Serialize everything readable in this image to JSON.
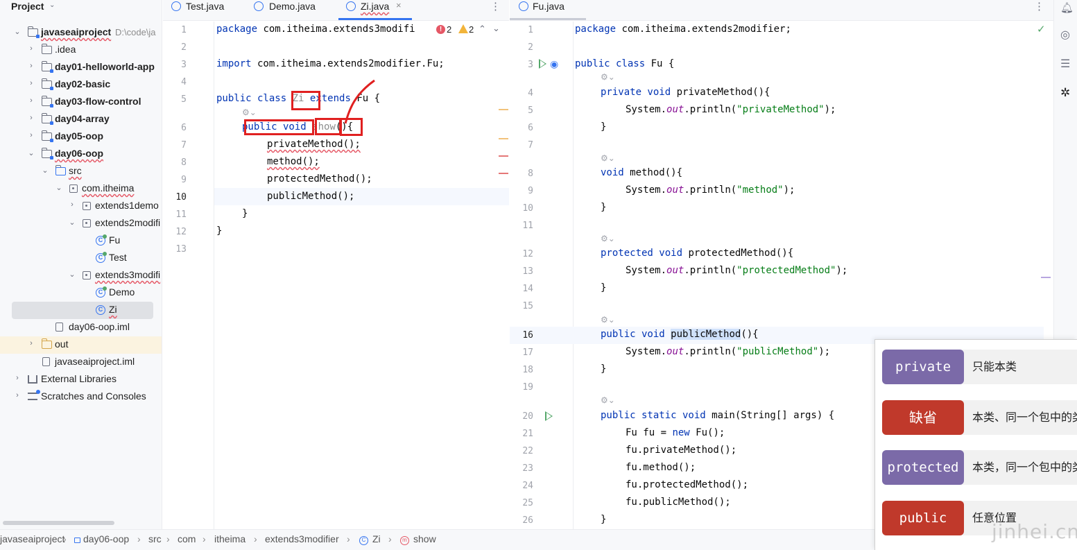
{
  "project_panel": {
    "title": "Project",
    "root": {
      "name": "javaseaiproject",
      "path": "D:\\code\\ja"
    },
    "items": [
      {
        "label": ".idea"
      },
      {
        "label": "day01-helloworld-app"
      },
      {
        "label": "day02-basic"
      },
      {
        "label": "day03-flow-control"
      },
      {
        "label": "day04-array"
      },
      {
        "label": "day05-oop"
      },
      {
        "label": "day06-oop"
      },
      {
        "label": "src"
      },
      {
        "label": "com.itheima"
      },
      {
        "label": "extends1demo"
      },
      {
        "label": "extends2modifi"
      },
      {
        "label": "Fu"
      },
      {
        "label": "Test"
      },
      {
        "label": "extends3modifi"
      },
      {
        "label": "Demo"
      },
      {
        "label": "Zi"
      },
      {
        "label": "day06-oop.iml"
      },
      {
        "label": "out"
      },
      {
        "label": "javaseaiproject.iml"
      },
      {
        "label": "External Libraries"
      },
      {
        "label": "Scratches and Consoles"
      }
    ]
  },
  "left_editor": {
    "tabs": [
      {
        "label": "Test.java"
      },
      {
        "label": "Demo.java"
      },
      {
        "label": "Zi.java",
        "close": "×"
      }
    ],
    "inspections": {
      "errors": "2",
      "warnings": "2"
    },
    "line_numbers": [
      "1",
      "2",
      "3",
      "4",
      "5",
      "6",
      "7",
      "8",
      "9",
      "10",
      "11",
      "12",
      "13"
    ],
    "code": {
      "l1_kw": "package",
      "l1_rest": " com.itheima.extends3modifi",
      "l3_kw": "import",
      "l3_rest": " com.itheima.extends2modifier.Fu;",
      "l5_kw1": "public class",
      "l5_cls": "Zi",
      "l5_kw2": "extends",
      "l5_rest": " Fu {",
      "l6_kw": "public void",
      "l6_name": "show",
      "l6_rest": "(){",
      "l7": "privateMethod();",
      "l8": "method();",
      "l9": "protectedMethod();",
      "l10": "publicMethod();",
      "l11": "}",
      "l12": "}"
    }
  },
  "right_editor": {
    "tabs": [
      {
        "label": "Fu.java"
      }
    ],
    "line_numbers": [
      "1",
      "2",
      "3",
      "4",
      "5",
      "6",
      "7",
      "8",
      "9",
      "10",
      "11",
      "12",
      "13",
      "14",
      "15",
      "16",
      "17",
      "18",
      "19",
      "20",
      "21",
      "22",
      "23",
      "24",
      "25",
      "26"
    ],
    "code": {
      "l1_kw": "package",
      "l1_rest": " com.itheima.extends2modifier;",
      "l3_kw": "public class",
      "l3_rest": " Fu {",
      "l4_kw": "private void",
      "l4_rest": " privateMethod(){",
      "l5_a": "System.",
      "l5_f": "out",
      "l5_b": ".println(",
      "l5_s": "\"privateMethod\"",
      "l5_c": ");",
      "l6": "}",
      "l8_kw": "void",
      "l8_rest": " method(){",
      "l9_a": "System.",
      "l9_f": "out",
      "l9_b": ".println(",
      "l9_s": "\"method\"",
      "l9_c": ");",
      "l10": "}",
      "l12_kw": "protected void",
      "l12_rest": " protectedMethod(){",
      "l13_a": "System.",
      "l13_f": "out",
      "l13_b": ".println(",
      "l13_s": "\"protectedMethod\"",
      "l13_c": ");",
      "l14": "}",
      "l16_kw": "public void",
      "l16_name": "publicMethod",
      "l16_rest": "(){",
      "l17_a": "System.",
      "l17_f": "out",
      "l17_b": ".println(",
      "l17_s": "\"publicMethod\"",
      "l17_c": ");",
      "l18": "}",
      "l20_kw": "public static void",
      "l20_rest": " main(String[] args) {",
      "l21_a": "Fu fu = ",
      "l21_kw": "new",
      "l21_b": " Fu();",
      "l22": "fu.privateMethod();",
      "l23": "fu.method();",
      "l24": "fu.protectedMethod();",
      "l25": "fu.publicMethod();",
      "l26": "}"
    }
  },
  "breadcrumb": [
    "javaseaiproject",
    "day06-oop",
    "src",
    "com",
    "itheima",
    "extends3modifier",
    "Zi",
    "show"
  ],
  "access_modifiers": [
    {
      "keyword": "private",
      "description": "只能本类",
      "color": "#7b6aa8"
    },
    {
      "keyword": "缺省",
      "description": "本类、同一个包中的类",
      "color": "#c0392b"
    },
    {
      "keyword": "protected",
      "description": "本类，同一个包中的类",
      "color": "#7b6aa8"
    },
    {
      "keyword": "public",
      "description": "任意位置",
      "color": "#c0392b"
    }
  ],
  "watermark": "jinhei.cn",
  "colors": {
    "accent": "#3574f0",
    "annotation_red": "#e02020",
    "keyword": "#0033b3",
    "string": "#067d17"
  }
}
